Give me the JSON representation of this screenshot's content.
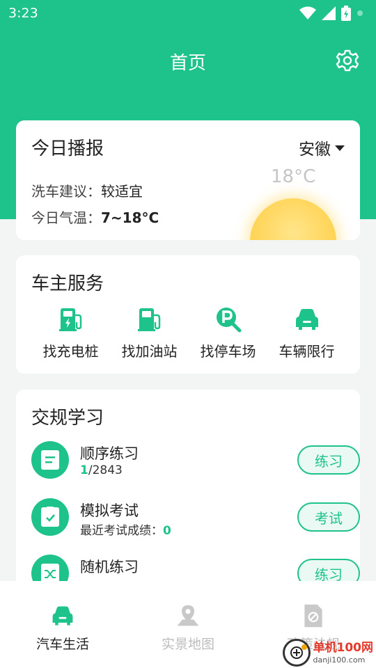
{
  "status_bar": {
    "time": "3:23"
  },
  "header": {
    "title": "首页"
  },
  "broadcast": {
    "title": "今日播报",
    "region": "安徽",
    "wash_label": "洗车建议：",
    "wash_value": "较适宜",
    "temp_label": "今日气温：",
    "temp_value": "7~18°C",
    "current_temp": "18°C"
  },
  "services": {
    "title": "车主服务",
    "items": [
      {
        "label": "找充电桩",
        "icon": "charging-station-icon"
      },
      {
        "label": "找加油站",
        "icon": "gas-station-icon"
      },
      {
        "label": "找停车场",
        "icon": "parking-search-icon"
      },
      {
        "label": "车辆限行",
        "icon": "car-icon"
      }
    ]
  },
  "study": {
    "title": "交规学习",
    "rows": [
      {
        "name": "顺序练习",
        "progress_current": "1",
        "progress_total": "/2843",
        "button": "练习"
      },
      {
        "name": "模拟考试",
        "score_label": "最近考试成绩：",
        "score_value": "0",
        "button": "考试"
      },
      {
        "name": "随机练习",
        "button": "练习"
      }
    ]
  },
  "tabs": [
    {
      "label": "汽车生活",
      "icon": "car-icon",
      "active": true
    },
    {
      "label": "实景地图",
      "icon": "map-pin-icon",
      "active": false
    },
    {
      "label": "政策法规",
      "icon": "document-icon",
      "active": false
    }
  ],
  "watermark": {
    "name": "单机100网",
    "url": "danji100.com"
  },
  "colors": {
    "accent": "#1ec28b",
    "background": "#f3f5f5",
    "sun": "#ffd457"
  }
}
